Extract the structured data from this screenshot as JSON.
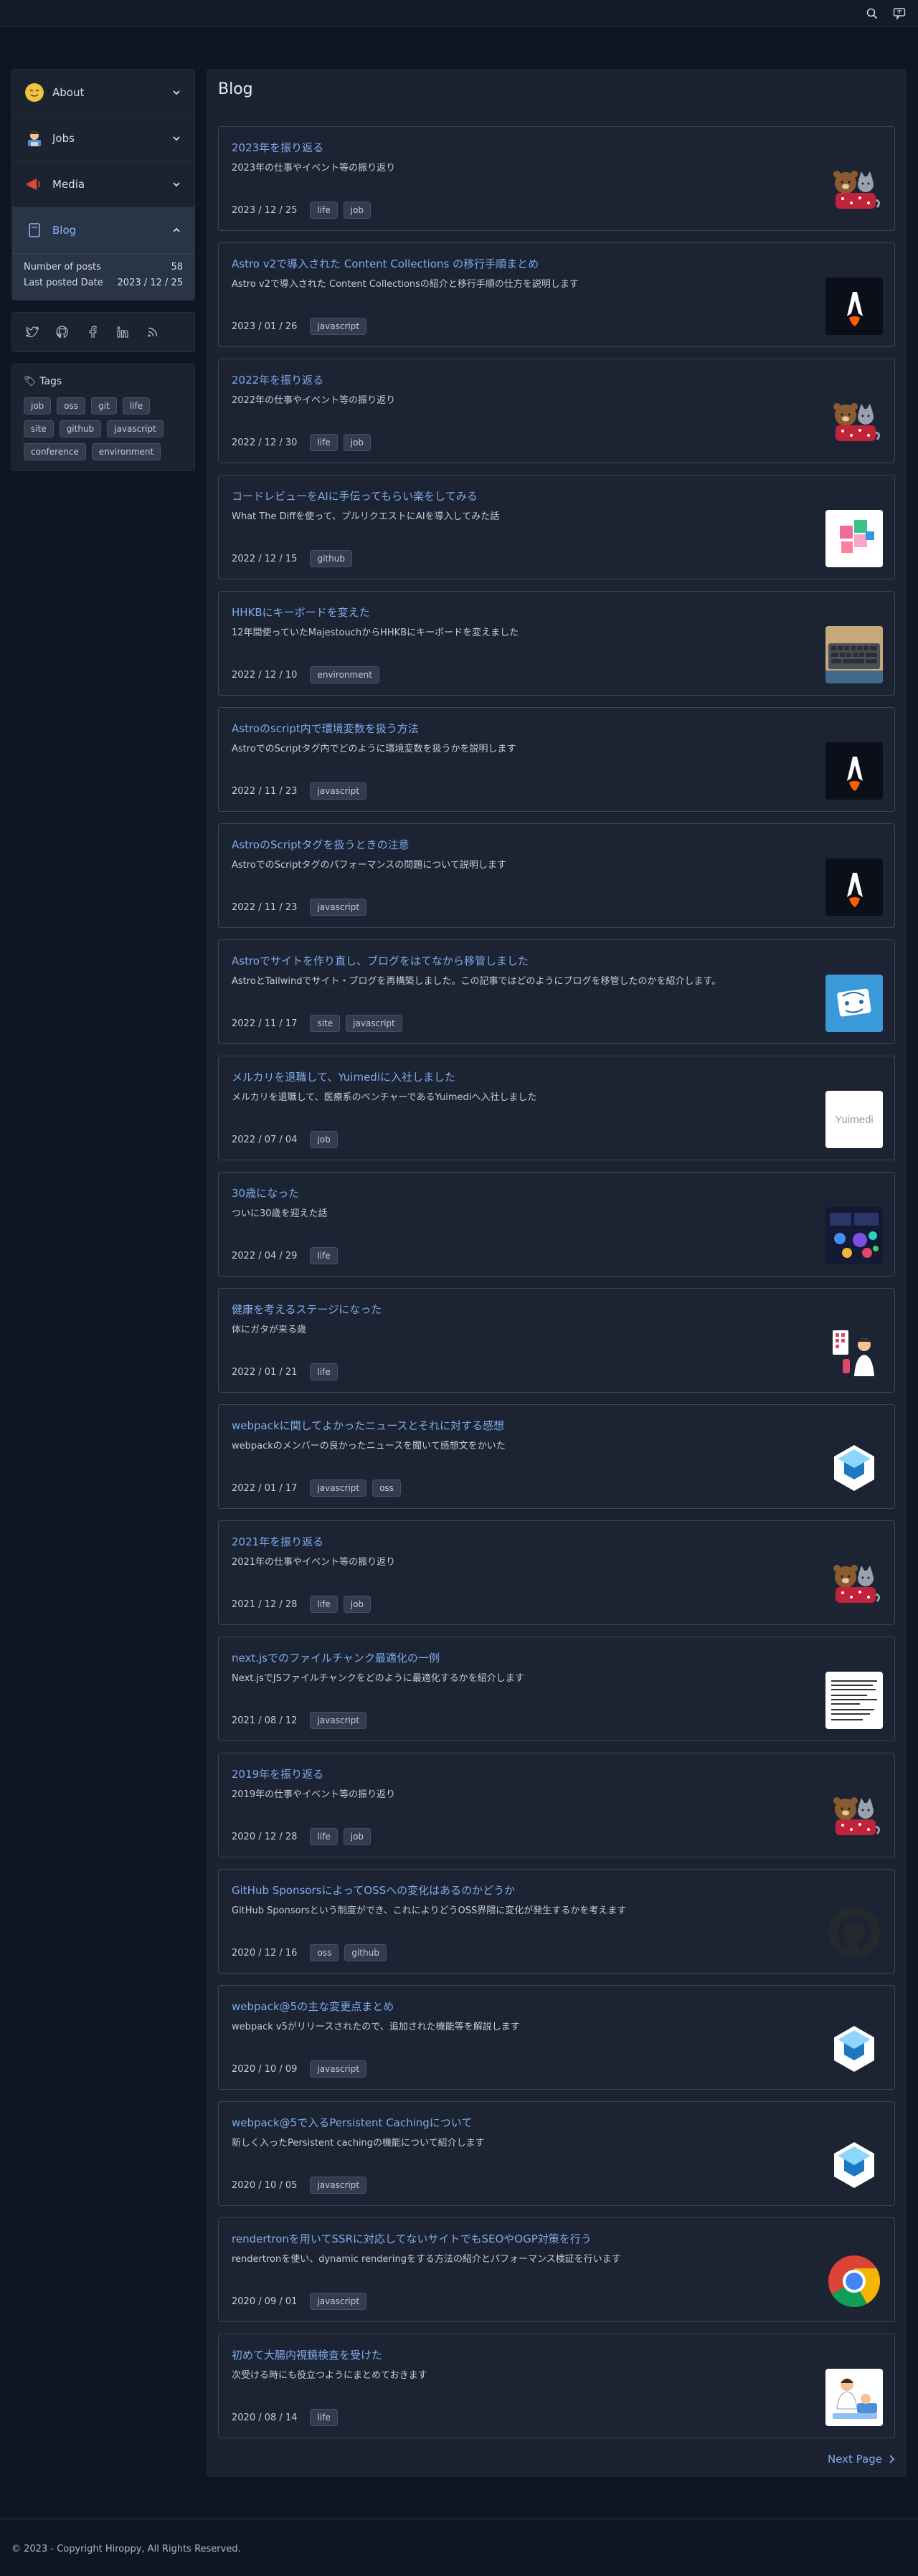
{
  "header": {
    "search_icon": "search-icon",
    "menu_icon": "translate-icon"
  },
  "sidebar": {
    "menu": [
      {
        "label": "About",
        "icon": "smile-face-icon"
      },
      {
        "label": "Jobs",
        "icon": "technologist-icon"
      },
      {
        "label": "Media",
        "icon": "megaphone-icon"
      },
      {
        "label": "Blog",
        "icon": "document-icon"
      }
    ],
    "blog_stats": {
      "posts_label": "Number of posts",
      "posts_value": "58",
      "last_label": "Last posted Date",
      "last_value": "2023 / 12 / 25"
    },
    "social": [
      "twitter-icon",
      "github-icon",
      "facebook-icon",
      "linkedin-icon",
      "rss-icon"
    ],
    "tags_title": "🏷 Tags",
    "tags": [
      "job",
      "oss",
      "git",
      "life",
      "site",
      "github",
      "javascript",
      "conference",
      "environment"
    ]
  },
  "main": {
    "title": "Blog",
    "next_label": "Next Page",
    "posts": [
      {
        "title": "2023年を振り返る",
        "desc": "2023年の仕事やイベント等の振り返り",
        "date": "2023 / 12 / 25",
        "tags": [
          "life",
          "job"
        ],
        "thumb": "bear-cat"
      },
      {
        "title": "Astro v2で導入された Content Collections の移行手順まとめ",
        "desc": "Astro v2で導入された Content Collectionsの紹介と移行手順の仕方を説明します",
        "date": "2023 / 01 / 26",
        "tags": [
          "javascript"
        ],
        "thumb": "astro"
      },
      {
        "title": "2022年を振り返る",
        "desc": "2022年の仕事やイベント等の振り返り",
        "date": "2022 / 12 / 30",
        "tags": [
          "life",
          "job"
        ],
        "thumb": "bear-cat"
      },
      {
        "title": "コードレビューをAIに手伝ってもらい楽をしてみる",
        "desc": "What The Diffを使って、プルリクエストにAIを導入してみた話",
        "date": "2022 / 12 / 15",
        "tags": [
          "github"
        ],
        "thumb": "blocks"
      },
      {
        "title": "HHKBにキーボードを変えた",
        "desc": "12年間使っていたMajestouchからHHKBにキーボードを変えました",
        "date": "2022 / 12 / 10",
        "tags": [
          "environment"
        ],
        "thumb": "keyboard"
      },
      {
        "title": "Astroのscript内で環境変数を扱う方法",
        "desc": "AstroでのScriptタグ内でどのように環境変数を扱うかを説明します",
        "date": "2022 / 11 / 23",
        "tags": [
          "javascript"
        ],
        "thumb": "astro"
      },
      {
        "title": "AstroのScriptタグを扱うときの注意",
        "desc": "AstroでのScriptタグのパフォーマンスの問題について説明します",
        "date": "2022 / 11 / 23",
        "tags": [
          "javascript"
        ],
        "thumb": "astro"
      },
      {
        "title": "Astroでサイトを作り直し、ブログをはてなから移管しました",
        "desc": "AstroとTailwindでサイト・ブログを再構築しました。この記事ではどのようにブログを移管したのかを紹介します。",
        "date": "2022 / 11 / 17",
        "tags": [
          "site",
          "javascript"
        ],
        "thumb": "site"
      },
      {
        "title": "メルカリを退職して、Yuimediに入社しました",
        "desc": "メルカリを退職して、医療系のベンチャーであるYuimediへ入社しました",
        "date": "2022 / 07 / 04",
        "tags": [
          "job"
        ],
        "thumb": "yuimedi",
        "thumb_text": "Yuimedi"
      },
      {
        "title": "30歳になった",
        "desc": "ついに30歳を迎えた話",
        "date": "2022 / 04 / 29",
        "tags": [
          "life"
        ],
        "thumb": "dashboard"
      },
      {
        "title": "健康を考えるステージになった",
        "desc": "体にガタが来る歳",
        "date": "2022 / 01 / 21",
        "tags": [
          "life"
        ],
        "thumb": "doctor"
      },
      {
        "title": "webpackに関してよかったニュースとそれに対する感想",
        "desc": "webpackのメンバーの良かったニュースを聞いて感想文をかいた",
        "date": "2022 / 01 / 17",
        "tags": [
          "javascript",
          "oss"
        ],
        "thumb": "webpack"
      },
      {
        "title": "2021年を振り返る",
        "desc": "2021年の仕事やイベント等の振り返り",
        "date": "2021 / 12 / 28",
        "tags": [
          "life",
          "job"
        ],
        "thumb": "bear-cat"
      },
      {
        "title": "next.jsでのファイルチャンク最適化の一例",
        "desc": "Next.jsでJSファイルチャンクをどのように最適化するかを紹介します",
        "date": "2021 / 08 / 12",
        "tags": [
          "javascript"
        ],
        "thumb": "doc"
      },
      {
        "title": "2019年を振り返る",
        "desc": "2019年の仕事やイベント等の振り返り",
        "date": "2020 / 12 / 28",
        "tags": [
          "life",
          "job"
        ],
        "thumb": "bear-cat"
      },
      {
        "title": "GitHub SponsorsによってOSSへの変化はあるのかどうか",
        "desc": "GitHub Sponsorsという制度ができ、これによりどうOSS界隈に変化が発生するかを考えます",
        "date": "2020 / 12 / 16",
        "tags": [
          "oss",
          "github"
        ],
        "thumb": "github"
      },
      {
        "title": "webpack@5の主な変更点まとめ",
        "desc": "webpack v5がリリースされたので、追加された機能等を解説します",
        "date": "2020 / 10 / 09",
        "tags": [
          "javascript"
        ],
        "thumb": "webpack"
      },
      {
        "title": "webpack@5で入るPersistent Cachingについて",
        "desc": "新しく入ったPersistent cachingの機能について紹介します",
        "date": "2020 / 10 / 05",
        "tags": [
          "javascript"
        ],
        "thumb": "webpack"
      },
      {
        "title": "rendertronを用いてSSRに対応してないサイトでもSEOやOGP対策を行う",
        "desc": "rendertronを使い、dynamic renderingをする方法の紹介とパフォーマンス検証を行います",
        "date": "2020 / 09 / 01",
        "tags": [
          "javascript"
        ],
        "thumb": "chrome"
      },
      {
        "title": "初めて大腸内視鏡検査を受けた",
        "desc": "次受ける時にも役立つようにまとめておきます",
        "date": "2020 / 08 / 14",
        "tags": [
          "life"
        ],
        "thumb": "doctor2"
      }
    ]
  },
  "footer": {
    "copyright": "© 2023 - Copyright Hiroppy, All Rights Reserved."
  }
}
